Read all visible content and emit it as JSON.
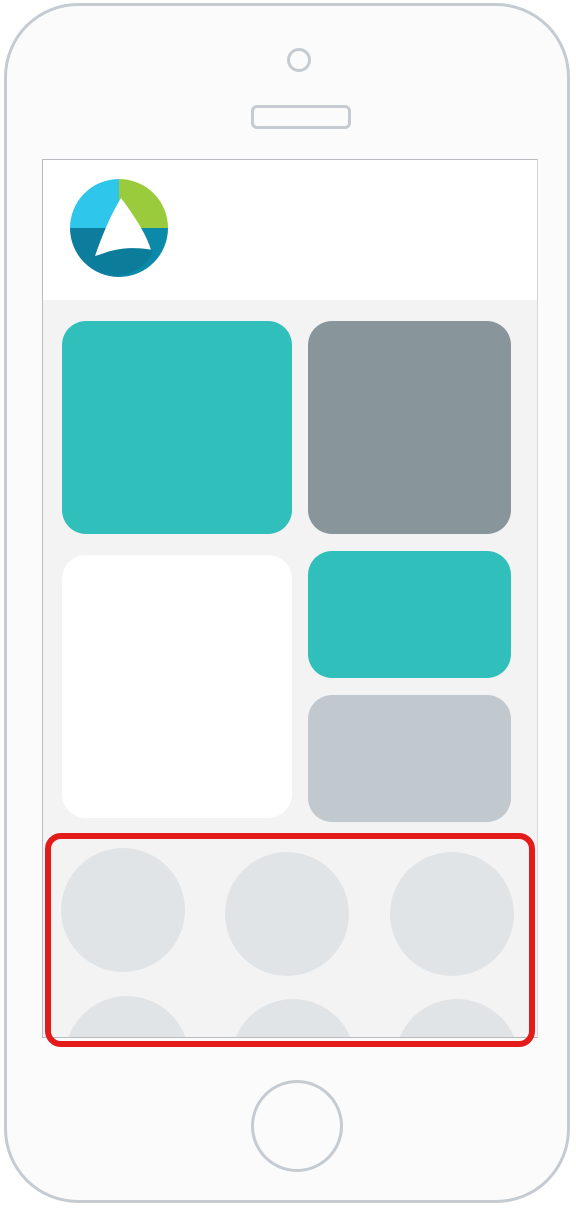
{
  "device": {
    "type": "smartphone",
    "frame_color": "#c5cbd0"
  },
  "header": {
    "logo_icon": "app-logo-icon"
  },
  "tiles": [
    {
      "name": "tile-top-left",
      "color": "#31bfbc"
    },
    {
      "name": "tile-top-right",
      "color": "#88959b"
    },
    {
      "name": "tile-middle-left",
      "color": "#ffffff"
    },
    {
      "name": "tile-middle-right",
      "color": "#31bfbc"
    },
    {
      "name": "tile-bottom-right",
      "color": "#c1c8ce"
    }
  ],
  "shortcut_circles": {
    "count": 6,
    "color": "#e1e4e7"
  },
  "highlight": {
    "color": "#e31b1b",
    "target": "shortcut-circles-section"
  }
}
